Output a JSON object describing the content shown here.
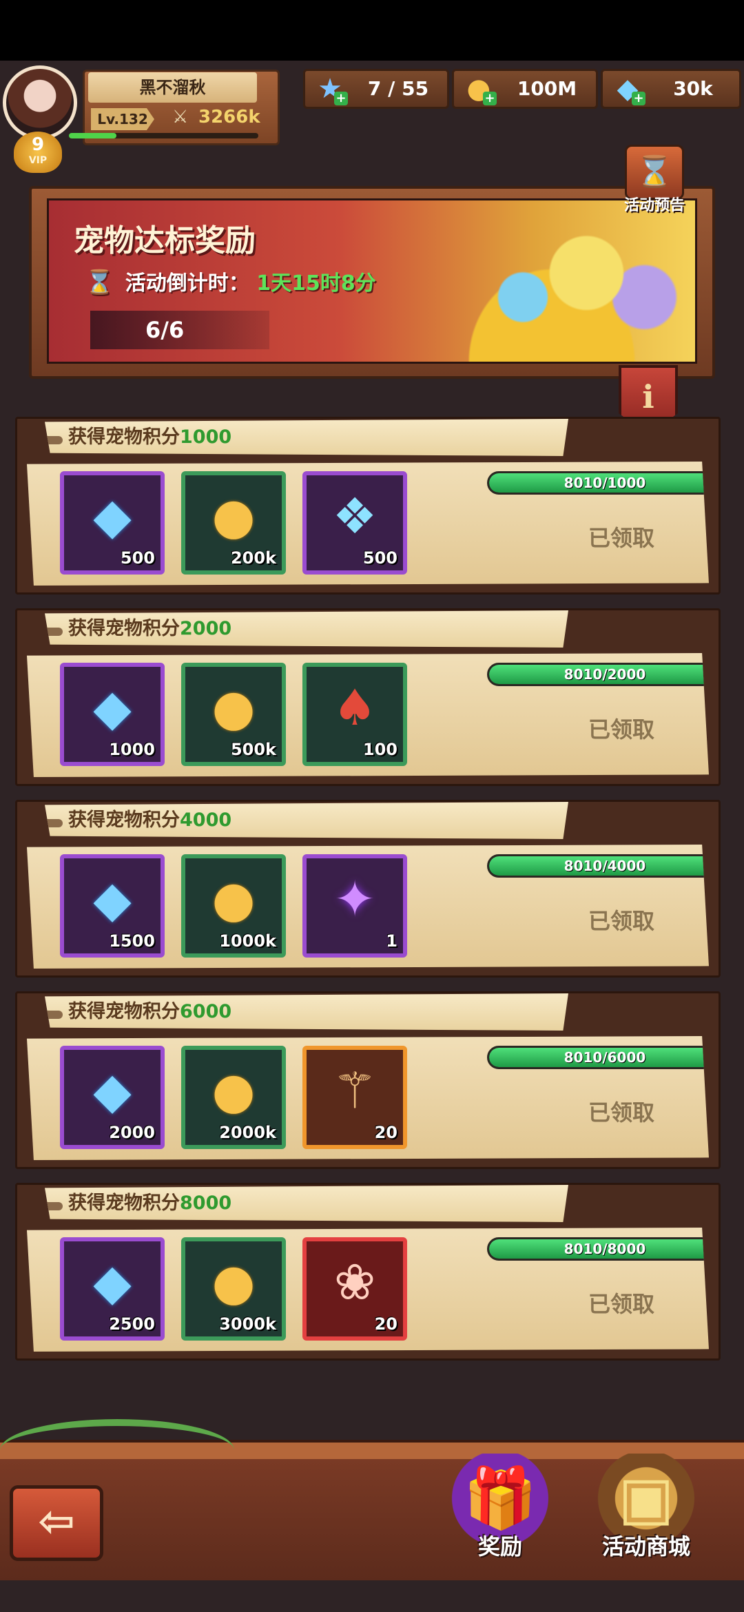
{
  "profile": {
    "name": "黑不溜秋",
    "level": "Lv.132",
    "power": "3266k",
    "vip_level": "9",
    "vip_label": "VIP",
    "xp_fraction": 0.25
  },
  "currencies": [
    {
      "icon": "star-icon",
      "glyph": "★",
      "value": "7 / 55"
    },
    {
      "icon": "coin-icon",
      "glyph": "●",
      "value": "100M"
    },
    {
      "icon": "diamond-icon",
      "glyph": "◆",
      "value": "30k"
    }
  ],
  "banner": {
    "title": "宠物达标奖励",
    "countdown_label": "活动倒计时：",
    "countdown_time": "1天15时8分",
    "progress": "6/6",
    "preview_label": "活动预告",
    "info_label": "i"
  },
  "rewards": [
    {
      "title_prefix": "获得宠物积分",
      "target": "1000",
      "progress_text": "8010/1000",
      "progress_fraction": 1.0,
      "status": "已领取",
      "items": [
        {
          "kind": "diamond",
          "frame": "purple",
          "glyph": "◆",
          "qty": "500"
        },
        {
          "kind": "coin",
          "frame": "green",
          "glyph": "●",
          "qty": "200k"
        },
        {
          "kind": "crystal",
          "frame": "purple",
          "glyph": "❖",
          "qty": "500"
        }
      ]
    },
    {
      "title_prefix": "获得宠物积分",
      "target": "2000",
      "progress_text": "8010/2000",
      "progress_fraction": 1.0,
      "status": "已领取",
      "items": [
        {
          "kind": "diamond",
          "frame": "purple",
          "glyph": "◆",
          "qty": "1000"
        },
        {
          "kind": "coin",
          "frame": "green",
          "glyph": "●",
          "qty": "500k"
        },
        {
          "kind": "bag",
          "frame": "green",
          "glyph": "♠",
          "qty": "100"
        }
      ]
    },
    {
      "title_prefix": "获得宠物积分",
      "target": "4000",
      "progress_text": "8010/4000",
      "progress_fraction": 1.0,
      "status": "已领取",
      "items": [
        {
          "kind": "diamond",
          "frame": "purple",
          "glyph": "◆",
          "qty": "1500"
        },
        {
          "kind": "coin",
          "frame": "green",
          "glyph": "●",
          "qty": "1000k"
        },
        {
          "kind": "orb",
          "frame": "purple",
          "glyph": "✦",
          "qty": "1"
        }
      ]
    },
    {
      "title_prefix": "获得宠物积分",
      "target": "6000",
      "progress_text": "8010/6000",
      "progress_fraction": 1.0,
      "status": "已领取",
      "items": [
        {
          "kind": "diamond",
          "frame": "purple",
          "glyph": "◆",
          "qty": "2000"
        },
        {
          "kind": "coin",
          "frame": "green",
          "glyph": "●",
          "qty": "2000k"
        },
        {
          "kind": "scroll",
          "frame": "orange",
          "glyph": "⚚",
          "qty": "20"
        }
      ]
    },
    {
      "title_prefix": "获得宠物积分",
      "target": "8000",
      "progress_text": "8010/8000",
      "progress_fraction": 1.0,
      "status": "已领取",
      "items": [
        {
          "kind": "diamond",
          "frame": "purple",
          "glyph": "◆",
          "qty": "2500"
        },
        {
          "kind": "coin",
          "frame": "green",
          "glyph": "●",
          "qty": "3000k"
        },
        {
          "kind": "paw",
          "frame": "red",
          "glyph": "❀",
          "qty": "20"
        }
      ]
    }
  ],
  "bottom_nav": {
    "back_glyph": "⇦",
    "reward_label": "奖励",
    "shop_label": "活动商城"
  },
  "colors": {
    "accent_green": "#2f9a2f",
    "countdown_green": "#5ee35a",
    "background": "#2e2325"
  }
}
